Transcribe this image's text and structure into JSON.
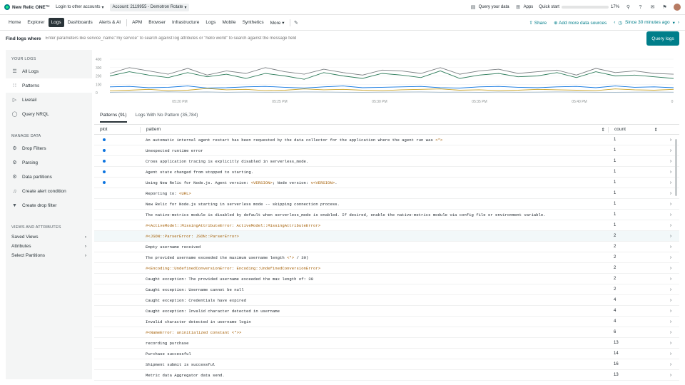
{
  "topbar": {
    "brand": "New Relic ONE™",
    "login_label": "Login to other accounts",
    "account_label": "Account: 2119955 - Demotron Rotate",
    "query_data": "Query your data",
    "apps": "Apps",
    "quick_start": "Quick start",
    "quick_start_progress": "17%",
    "quick_start_value": 0.17
  },
  "nav": {
    "items": [
      "Home",
      "Explorer",
      "Logs",
      "Dashboards",
      "Alerts & AI",
      "APM",
      "Browser",
      "Infrastructure",
      "Logs",
      "Mobile",
      "Synthetics",
      "More"
    ],
    "share": "Share",
    "add_data": "Add more data sources",
    "time": "Since 30 minutes ago"
  },
  "query": {
    "label": "Find logs where",
    "placeholder": "Enter parameters like service_name:\"my service\" to search against log attributes or \"hello world\" to search against the message field",
    "button": "Query logs"
  },
  "sidebar": {
    "your_logs": "YOUR LOGS",
    "items": [
      "All Logs",
      "Patterns",
      "Livetail",
      "Query NRQL"
    ],
    "manage": "MANAGE DATA",
    "manage_items": [
      "Drop Filters",
      "Parsing",
      "Data partitions",
      "Create alert condition",
      "Create drop filter"
    ],
    "views": "VIEWS AND ATTRIBUTES",
    "view_items": [
      "Saved Views",
      "Attributes",
      "Select Partitions"
    ]
  },
  "chart_data": {
    "type": "line",
    "y_ticks": [
      "400",
      "300",
      "200",
      "100",
      "0"
    ],
    "x_ticks": [
      "05:20 PM",
      "05:25 PM",
      "05:30 PM",
      "05:35 PM",
      "05:40 PM",
      "0"
    ],
    "ylim": [
      0,
      400
    ],
    "colors": [
      "#7a7f82",
      "#2e7d5b",
      "#0c74df",
      "#c9a227",
      "#9bb3c4"
    ]
  },
  "tabs": {
    "patterns": "Patterns (91)",
    "no_pattern": "Logs With No Pattern (35,784)"
  },
  "table": {
    "headers": {
      "plot": "plot",
      "pattern": "pattern",
      "count": "count"
    },
    "rows": [
      {
        "dot": true,
        "parts": [
          [
            "An automatic internal agent restart has been requested by the data collector for the application where the agent run was ",
            0
          ],
          [
            "<*>",
            1
          ]
        ],
        "count": "1"
      },
      {
        "dot": true,
        "parts": [
          [
            "Unexpected runtime error",
            0
          ]
        ],
        "count": "1"
      },
      {
        "dot": true,
        "parts": [
          [
            "Cross application tracing is explicitly disabled in serverless_mode.",
            0
          ]
        ],
        "count": "1"
      },
      {
        "dot": true,
        "parts": [
          [
            "Agent state changed from stopped to starting.",
            0
          ]
        ],
        "count": "1"
      },
      {
        "dot": true,
        "parts": [
          [
            "Using New Relic for Node.js. Agent version: ",
            0
          ],
          [
            "<VERSION>",
            1
          ],
          [
            "; Node version: ",
            0
          ],
          [
            "v<VERSION>",
            1
          ],
          [
            ".",
            0
          ]
        ],
        "count": "1"
      },
      {
        "dot": false,
        "parts": [
          [
            "Reporting to: ",
            0
          ],
          [
            "<URL>",
            1
          ]
        ],
        "count": "1"
      },
      {
        "dot": false,
        "parts": [
          [
            "New Relic for Node.js starting in serverless mode -- skipping connection process.",
            0
          ]
        ],
        "count": "1"
      },
      {
        "dot": false,
        "parts": [
          [
            "The native-metrics module is disabled by default when serverless_mode is enabled. If desired, enable the native-metrics module via config file or environment variable.",
            0
          ]
        ],
        "count": "1"
      },
      {
        "dot": false,
        "parts": [
          [
            "#<ActiveModel::MissingAttributeError: ActiveModel::MissingAttributeError>",
            1
          ]
        ],
        "count": "1"
      },
      {
        "dot": false,
        "parts": [
          [
            "#<JSON::ParserError: JSON::ParserError>",
            1
          ]
        ],
        "count": "2"
      },
      {
        "dot": false,
        "parts": [
          [
            "Empty username received",
            0
          ]
        ],
        "count": "2"
      },
      {
        "dot": false,
        "parts": [
          [
            "The provided username exceeded the maximum username length ",
            0
          ],
          [
            "<*>",
            1
          ],
          [
            " / 30)",
            0
          ]
        ],
        "count": "2"
      },
      {
        "dot": false,
        "parts": [
          [
            "#<Encoding::UndefinedConversionError: Encoding::UndefinedConversionError>",
            1
          ]
        ],
        "count": "2"
      },
      {
        "dot": false,
        "parts": [
          [
            "Caught exception: The provided username exceeded the max length of: 30",
            0
          ]
        ],
        "count": "2"
      },
      {
        "dot": false,
        "parts": [
          [
            "Caught exception: Username cannot be null",
            0
          ]
        ],
        "count": "2"
      },
      {
        "dot": false,
        "parts": [
          [
            "Caught exception: Credentials have expired",
            0
          ]
        ],
        "count": "4"
      },
      {
        "dot": false,
        "parts": [
          [
            "Caught exception: Invalid character detected in username",
            0
          ]
        ],
        "count": "4"
      },
      {
        "dot": false,
        "parts": [
          [
            "Invalid character detected in username login",
            0
          ]
        ],
        "count": "4"
      },
      {
        "dot": false,
        "parts": [
          [
            "#<NameError: uninitialized constant ",
            1
          ],
          [
            "<*>",
            1
          ],
          [
            ">",
            1
          ]
        ],
        "count": "6"
      },
      {
        "dot": false,
        "parts": [
          [
            "recording purchase",
            0
          ]
        ],
        "count": "13"
      },
      {
        "dot": false,
        "parts": [
          [
            "Purchase successful",
            0
          ]
        ],
        "count": "14"
      },
      {
        "dot": false,
        "parts": [
          [
            "Shipment submit is successful",
            0
          ]
        ],
        "count": "16"
      },
      {
        "dot": false,
        "parts": [
          [
            "Metric data Aggregator data send.",
            0
          ]
        ],
        "count": "13"
      }
    ]
  }
}
